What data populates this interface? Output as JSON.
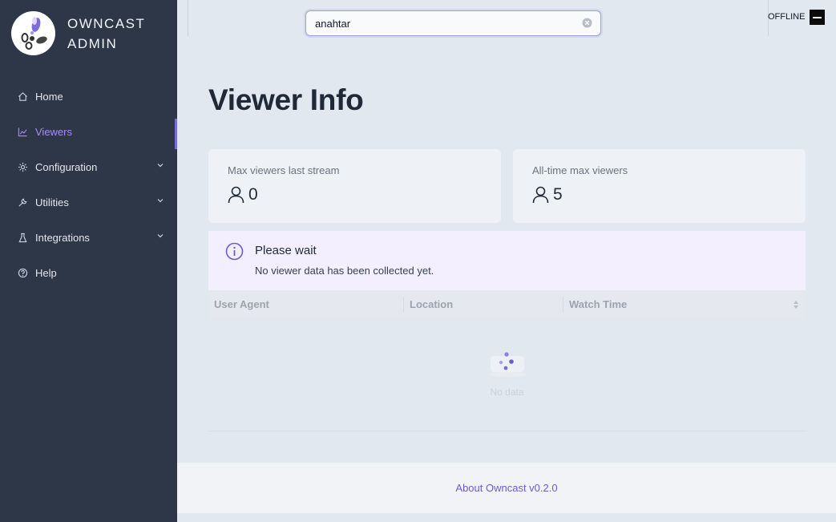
{
  "brand": {
    "line1": "OWNCAST",
    "line2": "ADMIN"
  },
  "sidebar": {
    "items": [
      {
        "label": "Home",
        "icon": "home-icon",
        "active": false,
        "expandable": false
      },
      {
        "label": "Viewers",
        "icon": "line-chart-icon",
        "active": true,
        "expandable": false
      },
      {
        "label": "Configuration",
        "icon": "gear-icon",
        "active": false,
        "expandable": true
      },
      {
        "label": "Utilities",
        "icon": "wrench-icon",
        "active": false,
        "expandable": true
      },
      {
        "label": "Integrations",
        "icon": "flask-icon",
        "active": false,
        "expandable": true
      },
      {
        "label": "Help",
        "icon": "question-circle-icon",
        "active": false,
        "expandable": false
      }
    ]
  },
  "header": {
    "search": {
      "value": "anahtar",
      "placeholder": ""
    },
    "status": "OFFLINE"
  },
  "main": {
    "title": "Viewer Info",
    "stats": [
      {
        "label": "Max viewers last stream",
        "value": "0",
        "icon": "user-icon"
      },
      {
        "label": "All-time max viewers",
        "value": "5",
        "icon": "user-icon"
      }
    ],
    "alert": {
      "title": "Please wait",
      "description": "No viewer data has been collected yet.",
      "icon": "info-circle-icon"
    },
    "table": {
      "columns": [
        "User Agent",
        "Location",
        "Watch Time"
      ],
      "empty_text": "No data"
    }
  },
  "footer": {
    "link": "About Owncast v0.2.0"
  },
  "colors": {
    "sidebar_bg": "#2d3748",
    "accent": "#7c6bdc",
    "page_bg": "#e2e8f0"
  }
}
